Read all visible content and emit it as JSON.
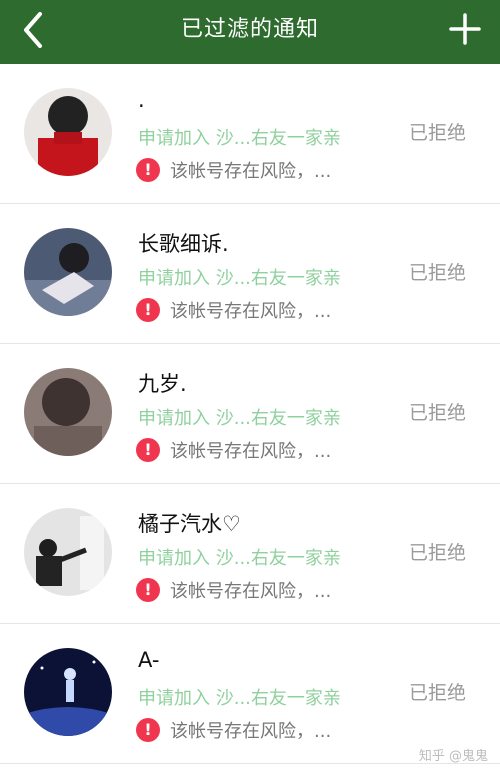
{
  "header": {
    "title": "已过滤的通知",
    "back_icon": "chevron-left-icon",
    "add_icon": "plus-icon"
  },
  "notifications": [
    {
      "name": ".",
      "request": "申请加入 沙...右友一家亲",
      "warning": "该帐号存在风险，...",
      "status": "已拒绝"
    },
    {
      "name": "长歌细诉.",
      "request": "申请加入 沙...右友一家亲",
      "warning": "该帐号存在风险，...",
      "status": "已拒绝"
    },
    {
      "name": "九岁.",
      "request": "申请加入 沙...右友一家亲",
      "warning": "该帐号存在风险，...",
      "status": "已拒绝"
    },
    {
      "name": "橘子汽水♡",
      "request": "申请加入 沙...右友一家亲",
      "warning": "该帐号存在风险，...",
      "status": "已拒绝"
    },
    {
      "name": "A-",
      "request": "申请加入 沙...右友一家亲",
      "warning": "该帐号存在风险，...",
      "status": "已拒绝"
    }
  ],
  "watermark": "知乎 @鬼鬼",
  "colors": {
    "header_bg": "#2e6b2f",
    "request_text": "#8fd19e",
    "warning_icon": "#f0364f",
    "status_text": "#9a9a9a"
  }
}
